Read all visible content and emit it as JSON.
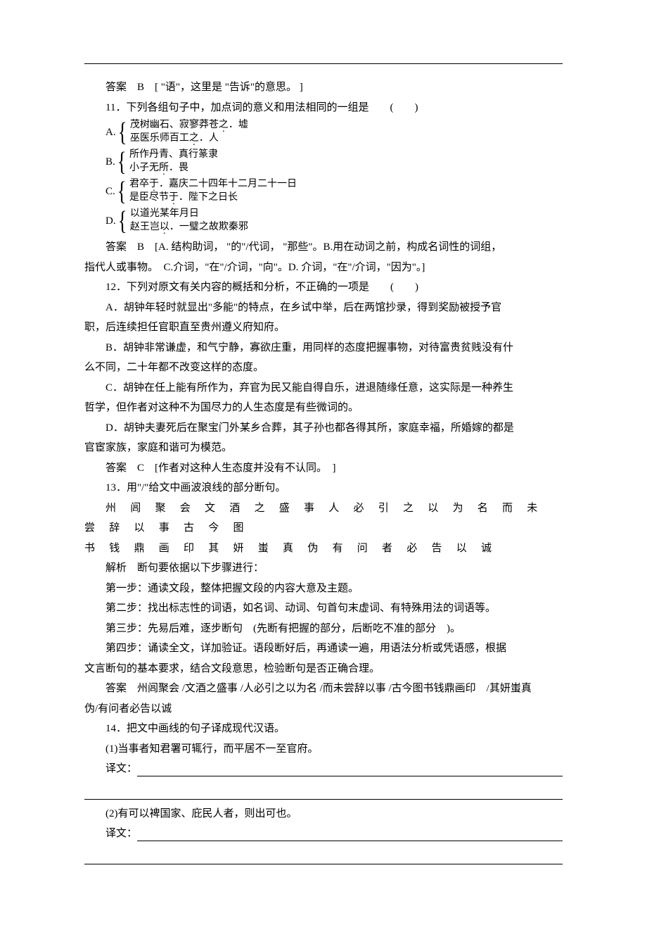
{
  "lines": {
    "ans10": "答案　B　[ \"语\"，这里是 \"告诉\"的意思。 ]",
    "q11": "11．下列各组句子中，加点词的意义和用法相同的一组是　　(　　)",
    "optA1": "茂树幽石、寂寥莽苍之．墟",
    "optA2": "巫医乐师百工之．人",
    "optB1": "所作丹青、真行篆隶",
    "optB2": "小子无所．畏",
    "optC1": "君卒于．嘉庆二十四年十二月二十一日",
    "optC2": "是臣尽节于．陛下之日长",
    "optD1": "以道光某年月日",
    "optD2": "赵王岂以．一璧之故欺秦邪",
    "ans11a": "答案　B　[A. 结构助词， \"的\"/代词， \"那些\"。B.用在动词之前，构成名词性的词组，",
    "ans11b": "指代人或事物。　C.介词，\"在\"/介词，\"向\"。D. 介词，\"在\"/介词，\"因为\"。]",
    "q12": "12．下列对原文有关内容的概括和分析，不正确的一项是　　(　　)",
    "q12A": "A．胡钟年轻时就显出\"多能\"的特点，在乡试中举，后在两馆抄录，得到奖励被授予官",
    "q12A2": "职，后连续担任官职直至贵州遵义府知府。",
    "q12B": "B．胡钟非常谦虚，和气宁静，寡欲庄重，用同样的态度把握事物，对待富贵贫贱没有什",
    "q12B2": "么不同，二十年都不改变这样的态度。",
    "q12C": "C．胡钟在任上能有所作为，弃官为民又能自得自乐，进退随缘任意，这实际是一种养生",
    "q12C2": "哲学，但作者对这种不为国尽力的人生态度是有些微词的。",
    "q12D": "D．胡钟夫妻死后在聚宝门外某乡合葬，其子孙也都各得其所，家庭幸福，所婚嫁的都是",
    "q12D2": "官宦家族，家庭和谐可为模范。",
    "ans12": "答案　C　[作者对这种人生态度并没有不认同。　]",
    "q13": "13．用\"/\"给文中画波浪线的部分断句。",
    "q13body1": "州 闾 聚 会 文 酒 之 盛 事 人 必 引 之 以 为 名 而 未 尝 辞 以 事 古 今 图",
    "q13body2": "书 钱 鼎 画 印 其 妍 蚩 真 伪 有 问 者 必 告 以 诚",
    "jiexi": "解析　断句要依据以下步骤进行：",
    "step1": "第一步：通读文段，整体把握文段的内容大意及主题。",
    "step2": "第二步：找出标志性的词语，如名词、动词、句首句末虚词、有特殊用法的词语等。",
    "step3": "第三步：先易后难，逐步断句　(先断有把握的部分，后断吃不准的部分　)。",
    "step4": "第四步：诵读全文，详加验证。语段断好后，再通读一遍，用语法分析或凭语感，根据",
    "step4b": "文言断句的基本要求，结合文段意思，检验断句是否正确合理。",
    "ans13a": "答案　州闾聚会 /文酒之盛事 /人必引之以为名 /而未尝辞以事 /古今图书钱鼎画印　/其妍蚩真",
    "ans13b": "伪/有问者必告以诚",
    "q14": "14．把文中画线的句子译成现代汉语。",
    "q14_1": "(1)当事者知君署可辄行，而平居不一至官府。",
    "yiwen": "译文：",
    "q14_2": "(2)有可以裨国家、庇民人者，则出可也。"
  }
}
